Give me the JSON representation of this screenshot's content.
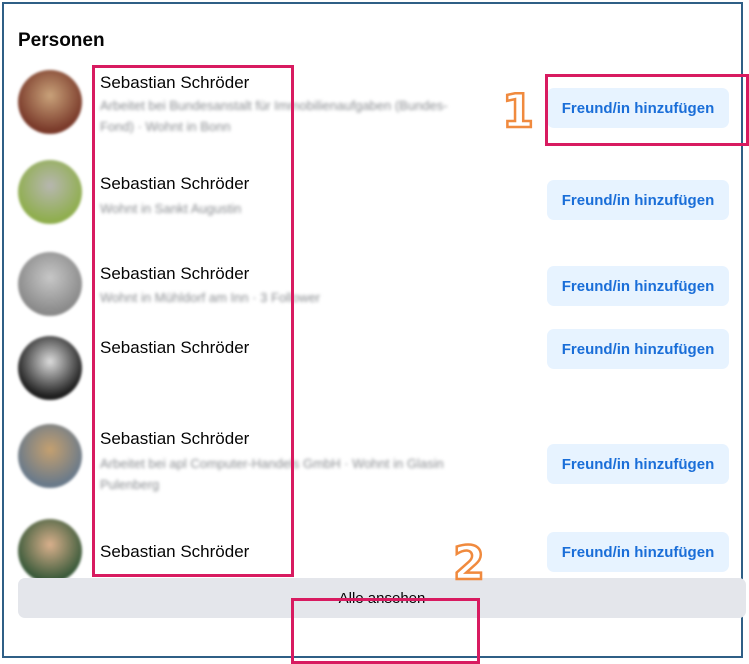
{
  "section_title": "Personen",
  "people": [
    {
      "name": "Sebastian Schröder",
      "subtitle": "Arbeitet bei Bundesanstalt für Immobilienaufgaben (Bundes-Fond) · Wohnt in Bonn",
      "button": "Freund/in hinzufügen",
      "avatar_colors": [
        "#7a3a2a",
        "#c9a27a"
      ]
    },
    {
      "name": "Sebastian Schröder",
      "subtitle": "Wohnt in Sankt Augustin",
      "button": "Freund/in hinzufügen",
      "avatar_colors": [
        "#8fae4e",
        "#b7b7b0"
      ]
    },
    {
      "name": "Sebastian Schröder",
      "subtitle": "Wohnt in Mühldorf am Inn · 3 Follower",
      "button": "Freund/in hinzufügen",
      "avatar_colors": [
        "#8a8a8a",
        "#c7c7c7"
      ]
    },
    {
      "name": "Sebastian Schröder",
      "subtitle": "",
      "button": "Freund/in hinzufügen",
      "avatar_colors": [
        "#1e1e1e",
        "#dcdcdc"
      ]
    },
    {
      "name": "Sebastian Schröder",
      "subtitle": "Arbeitet bei apl Computer-Handels GmbH · Wohnt in Glasin Pulenberg",
      "button": "Freund/in hinzufügen",
      "avatar_colors": [
        "#6a7a8a",
        "#c4a070"
      ]
    },
    {
      "name": "Sebastian Schröder",
      "subtitle": "",
      "button": "Freund/in hinzufügen",
      "avatar_colors": [
        "#3a5a3a",
        "#d9b08c"
      ]
    }
  ],
  "see_all_label": "Alle ansehen",
  "annotations": [
    "1",
    "2"
  ],
  "colors": {
    "highlight": "#d81b60",
    "number_outline": "#f08a3e",
    "button_bg": "#e7f3ff",
    "button_text": "#1a6ed8",
    "border": "#2f5f86"
  }
}
